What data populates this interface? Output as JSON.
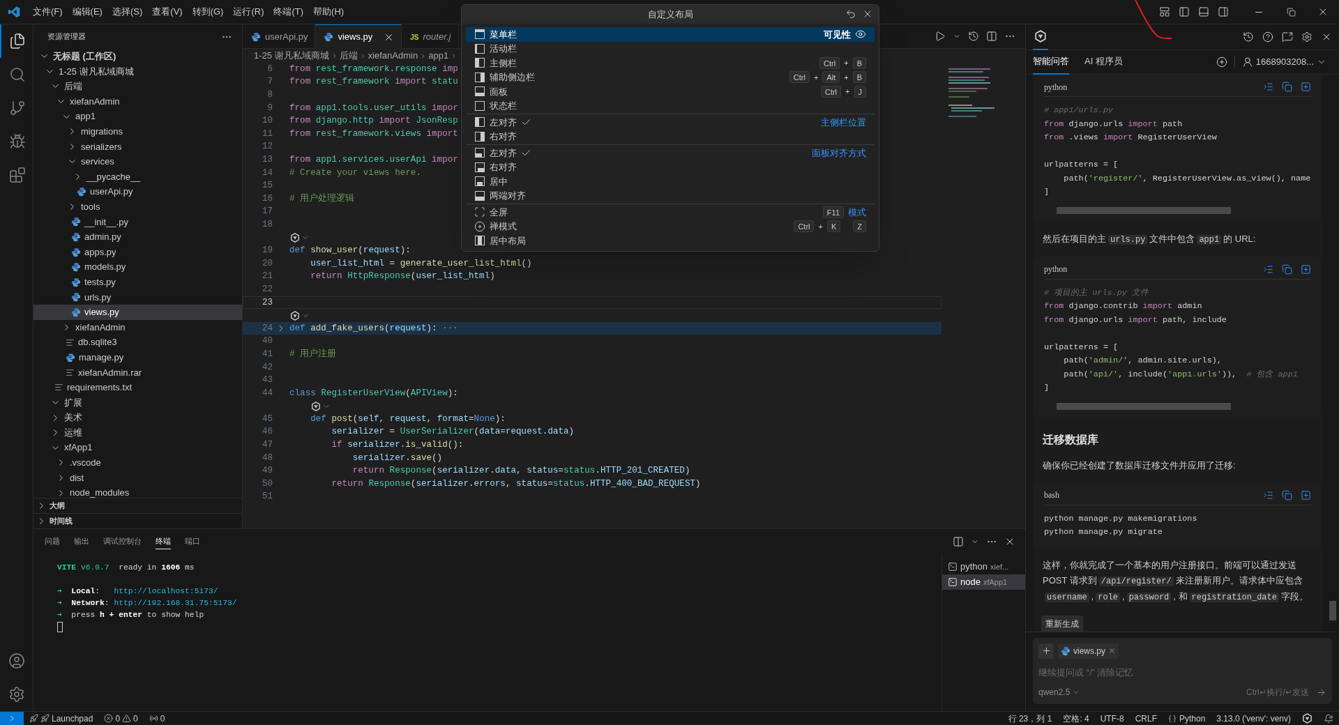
{
  "title_bar": {
    "menu": [
      "文件(F)",
      "编辑(E)",
      "选择(S)",
      "查看(V)",
      "转到(G)",
      "运行(R)",
      "终端(T)",
      "帮助(H)"
    ]
  },
  "activity_bar": {
    "items": [
      {
        "selected": true
      },
      {
        "selected": false
      },
      {
        "selected": false
      },
      {
        "selected": false
      },
      {
        "selected": false
      }
    ]
  },
  "sidebar": {
    "title": "资源管理器",
    "tree": [
      {
        "label": "无标题 (工作区)",
        "kind": "root",
        "expanded": true,
        "selected": false,
        "children": [
          {
            "label": "1-25 谢凡私域商城",
            "kind": "folder",
            "expanded": true,
            "selected": false,
            "children": [
              {
                "label": "后端",
                "kind": "folder",
                "expanded": true,
                "selected": false,
                "children": [
                  {
                    "label": "xiefanAdmin",
                    "kind": "folder",
                    "expanded": true,
                    "selected": false,
                    "children": [
                      {
                        "label": "app1",
                        "kind": "folder",
                        "expanded": true,
                        "selected": false,
                        "children": [
                          {
                            "label": "migrations",
                            "kind": "folder",
                            "expanded": false,
                            "selected": false
                          },
                          {
                            "label": "serializers",
                            "kind": "folder",
                            "expanded": false,
                            "selected": false
                          },
                          {
                            "label": "services",
                            "kind": "folder",
                            "expanded": true,
                            "selected": false,
                            "children": [
                              {
                                "label": "__pycache__",
                                "kind": "folder",
                                "expanded": false,
                                "selected": false
                              },
                              {
                                "label": "userApi.py",
                                "kind": "py",
                                "selected": false
                              }
                            ]
                          },
                          {
                            "label": "tools",
                            "kind": "folder",
                            "expanded": false,
                            "selected": false
                          },
                          {
                            "label": "__init__.py",
                            "kind": "py",
                            "selected": false
                          },
                          {
                            "label": "admin.py",
                            "kind": "py",
                            "selected": false
                          },
                          {
                            "label": "apps.py",
                            "kind": "py",
                            "selected": false
                          },
                          {
                            "label": "models.py",
                            "kind": "py",
                            "selected": false
                          },
                          {
                            "label": "tests.py",
                            "kind": "py",
                            "selected": false
                          },
                          {
                            "label": "urls.py",
                            "kind": "py",
                            "selected": false
                          },
                          {
                            "label": "views.py",
                            "kind": "py",
                            "selected": true
                          }
                        ]
                      },
                      {
                        "label": "xiefanAdmin",
                        "kind": "folder",
                        "expanded": false,
                        "selected": false
                      },
                      {
                        "label": "db.sqlite3",
                        "kind": "file",
                        "selected": false
                      },
                      {
                        "label": "manage.py",
                        "kind": "py",
                        "selected": false
                      },
                      {
                        "label": "xiefanAdmin.rar",
                        "kind": "file",
                        "selected": false
                      }
                    ]
                  }
                ]
              },
              {
                "label": "requirements.txt",
                "kind": "file",
                "selected": false
              },
              {
                "label": "扩展",
                "kind": "folder",
                "expanded": true,
                "selected": false
              },
              {
                "label": "美术",
                "kind": "folder",
                "expanded": false,
                "selected": false
              },
              {
                "label": "运维",
                "kind": "folder",
                "expanded": false,
                "selected": false
              },
              {
                "label": "xfApp1",
                "kind": "folder",
                "expanded": true,
                "selected": false,
                "children": [
                  {
                    "label": ".vscode",
                    "kind": "folder",
                    "expanded": false,
                    "selected": false
                  },
                  {
                    "label": "dist",
                    "kind": "folder",
                    "expanded": false,
                    "selected": false
                  },
                  {
                    "label": "node_modules",
                    "kind": "folder",
                    "expanded": false,
                    "selected": false
                  }
                ]
              }
            ]
          }
        ]
      }
    ],
    "sections": [
      {
        "label": "大纲",
        "expanded": false
      },
      {
        "label": "时间线",
        "expanded": false
      }
    ]
  },
  "editor": {
    "tabs": [
      {
        "label": "userApi.py",
        "kind": "py",
        "selected": false,
        "preview": false
      },
      {
        "label": "views.py",
        "kind": "py",
        "selected": true,
        "preview": false
      },
      {
        "label": "router.j",
        "kind": "js",
        "icon_text": "JS",
        "selected": false,
        "preview": true
      }
    ],
    "breadcrumb": [
      "1-25 谢凡私域商城",
      "后端",
      "xiefanAdmin",
      "app1"
    ],
    "lines": [
      {
        "kind": "code",
        "number": "6",
        "current": false,
        "folded": false,
        "tokens": [
          {
            "kind": "kw",
            "text": "from "
          },
          {
            "kind": "cls",
            "text": "rest_framework.response "
          },
          {
            "kind": "kw",
            "text": "imp"
          }
        ]
      },
      {
        "kind": "code",
        "number": "7",
        "current": false,
        "folded": false,
        "tokens": [
          {
            "kind": "kw",
            "text": "from "
          },
          {
            "kind": "cls",
            "text": "rest_framework "
          },
          {
            "kind": "kw",
            "text": "import "
          },
          {
            "kind": "cls",
            "text": "statu"
          }
        ]
      },
      {
        "kind": "blank",
        "number": "8",
        "current": false,
        "folded": false
      },
      {
        "kind": "code",
        "number": "9",
        "current": false,
        "folded": false,
        "tokens": [
          {
            "kind": "kw",
            "text": "from "
          },
          {
            "kind": "cls",
            "text": "app1.tools.user_utils "
          },
          {
            "kind": "kw",
            "text": "impor"
          }
        ]
      },
      {
        "kind": "code",
        "number": "10",
        "current": false,
        "folded": false,
        "tokens": [
          {
            "kind": "kw",
            "text": "from "
          },
          {
            "kind": "cls",
            "text": "django.http "
          },
          {
            "kind": "kw",
            "text": "import "
          },
          {
            "kind": "cls",
            "text": "JsonResp"
          }
        ]
      },
      {
        "kind": "code",
        "number": "11",
        "current": false,
        "folded": false,
        "tokens": [
          {
            "kind": "kw",
            "text": "from "
          },
          {
            "kind": "cls",
            "text": "rest_framework.views "
          },
          {
            "kind": "kw",
            "text": "import"
          }
        ]
      },
      {
        "kind": "blank",
        "number": "12",
        "current": false,
        "folded": false
      },
      {
        "kind": "code",
        "number": "13",
        "current": false,
        "folded": false,
        "tokens": [
          {
            "kind": "kw",
            "text": "from "
          },
          {
            "kind": "cls",
            "text": "app1.services.userApi "
          },
          {
            "kind": "kw",
            "text": "impor"
          }
        ]
      },
      {
        "kind": "code",
        "number": "14",
        "current": false,
        "folded": false,
        "tokens": [
          {
            "kind": "cm",
            "text": "# Create your views here."
          }
        ]
      },
      {
        "kind": "blank",
        "number": "15",
        "current": false,
        "folded": false
      },
      {
        "kind": "code",
        "number": "16",
        "current": false,
        "folded": false,
        "tokens": [
          {
            "kind": "cm",
            "text": "# 用户处理逻辑"
          }
        ]
      },
      {
        "kind": "blank",
        "number": "17",
        "current": false,
        "folded": false
      },
      {
        "kind": "blank",
        "number": "18",
        "current": false,
        "folded": false
      },
      {
        "kind": "lens"
      },
      {
        "kind": "code",
        "number": "19",
        "current": false,
        "folded": false,
        "tokens": [
          {
            "kind": "def",
            "text": "def "
          },
          {
            "kind": "fn",
            "text": "show_user"
          },
          {
            "kind": "p",
            "text": "("
          },
          {
            "kind": "var",
            "text": "request"
          },
          {
            "kind": "p",
            "text": "):"
          }
        ]
      },
      {
        "kind": "code",
        "number": "20",
        "current": false,
        "folded": false,
        "tokens": [
          {
            "kind": "var",
            "text": "    user_list_html"
          },
          {
            "kind": "p",
            "text": " = "
          },
          {
            "kind": "fn",
            "text": "generate_user_list_html"
          },
          {
            "kind": "p",
            "text": "()"
          }
        ]
      },
      {
        "kind": "code",
        "number": "21",
        "current": false,
        "folded": false,
        "tokens": [
          {
            "kind": "kw",
            "text": "    return "
          },
          {
            "kind": "cls",
            "text": "HttpResponse"
          },
          {
            "kind": "p",
            "text": "("
          },
          {
            "kind": "var",
            "text": "user_list_html"
          },
          {
            "kind": "p",
            "text": ")"
          }
        ]
      },
      {
        "kind": "blank",
        "number": "22",
        "current": false,
        "folded": false
      },
      {
        "kind": "blank",
        "number": "23",
        "current": true,
        "folded": false
      },
      {
        "kind": "lens"
      },
      {
        "kind": "code",
        "number": "24",
        "current": false,
        "folded": true,
        "tokens": [
          {
            "kind": "def",
            "text": "def "
          },
          {
            "kind": "fn",
            "text": "add_fake_users"
          },
          {
            "kind": "p",
            "text": "("
          },
          {
            "kind": "var",
            "text": "request"
          },
          {
            "kind": "p",
            "text": "):"
          },
          {
            "kind": "fold",
            "text": " ···"
          }
        ]
      },
      {
        "kind": "blank",
        "number": "40",
        "current": false,
        "folded": false
      },
      {
        "kind": "code",
        "number": "41",
        "current": false,
        "folded": false,
        "tokens": [
          {
            "kind": "cm",
            "text": "# 用户注册"
          }
        ]
      },
      {
        "kind": "blank",
        "number": "42",
        "current": false,
        "folded": false
      },
      {
        "kind": "blank",
        "number": "43",
        "current": false,
        "folded": false
      },
      {
        "kind": "code",
        "number": "44",
        "current": false,
        "folded": false,
        "tokens": [
          {
            "kind": "def",
            "text": "class "
          },
          {
            "kind": "cls",
            "text": "RegisterUserView"
          },
          {
            "kind": "p",
            "text": "("
          },
          {
            "kind": "cls",
            "text": "APIView"
          },
          {
            "kind": "p",
            "text": "):"
          }
        ]
      },
      {
        "kind": "lens-inner"
      },
      {
        "kind": "code",
        "number": "45",
        "current": false,
        "folded": false,
        "tokens": [
          {
            "kind": "def",
            "text": "    def "
          },
          {
            "kind": "fn",
            "text": "post"
          },
          {
            "kind": "p",
            "text": "("
          },
          {
            "kind": "var",
            "text": "self"
          },
          {
            "kind": "p",
            "text": ", "
          },
          {
            "kind": "var",
            "text": "request"
          },
          {
            "kind": "p",
            "text": ", "
          },
          {
            "kind": "var",
            "text": "format"
          },
          {
            "kind": "p",
            "text": "="
          },
          {
            "kind": "def",
            "text": "None"
          },
          {
            "kind": "p",
            "text": "):"
          }
        ]
      },
      {
        "kind": "code",
        "number": "46",
        "current": false,
        "folded": false,
        "tokens": [
          {
            "kind": "var",
            "text": "        serializer"
          },
          {
            "kind": "p",
            "text": " = "
          },
          {
            "kind": "cls",
            "text": "UserSerializer"
          },
          {
            "kind": "p",
            "text": "("
          },
          {
            "kind": "var",
            "text": "data"
          },
          {
            "kind": "p",
            "text": "="
          },
          {
            "kind": "var",
            "text": "request"
          },
          {
            "kind": "p",
            "text": "."
          },
          {
            "kind": "var",
            "text": "data"
          },
          {
            "kind": "p",
            "text": ")"
          }
        ]
      },
      {
        "kind": "code",
        "number": "47",
        "current": false,
        "folded": false,
        "tokens": [
          {
            "kind": "kw",
            "text": "        if "
          },
          {
            "kind": "var",
            "text": "serializer"
          },
          {
            "kind": "p",
            "text": "."
          },
          {
            "kind": "fn",
            "text": "is_valid"
          },
          {
            "kind": "p",
            "text": "():"
          }
        ]
      },
      {
        "kind": "code",
        "number": "48",
        "current": false,
        "folded": false,
        "tokens": [
          {
            "kind": "var",
            "text": "            serializer"
          },
          {
            "kind": "p",
            "text": "."
          },
          {
            "kind": "fn",
            "text": "save"
          },
          {
            "kind": "p",
            "text": "()"
          }
        ]
      },
      {
        "kind": "code",
        "number": "49",
        "current": false,
        "folded": false,
        "tokens": [
          {
            "kind": "kw",
            "text": "            return "
          },
          {
            "kind": "cls",
            "text": "Response"
          },
          {
            "kind": "p",
            "text": "("
          },
          {
            "kind": "var",
            "text": "serializer"
          },
          {
            "kind": "p",
            "text": "."
          },
          {
            "kind": "var",
            "text": "data"
          },
          {
            "kind": "p",
            "text": ", "
          },
          {
            "kind": "var",
            "text": "status"
          },
          {
            "kind": "p",
            "text": "="
          },
          {
            "kind": "cls",
            "text": "status"
          },
          {
            "kind": "p",
            "text": "."
          },
          {
            "kind": "var",
            "text": "HTTP_201_CREATED"
          },
          {
            "kind": "p",
            "text": ")"
          }
        ]
      },
      {
        "kind": "code",
        "number": "50",
        "current": false,
        "folded": false,
        "tokens": [
          {
            "kind": "kw",
            "text": "        return "
          },
          {
            "kind": "cls",
            "text": "Response"
          },
          {
            "kind": "p",
            "text": "("
          },
          {
            "kind": "var",
            "text": "serializer"
          },
          {
            "kind": "p",
            "text": "."
          },
          {
            "kind": "var",
            "text": "errors"
          },
          {
            "kind": "p",
            "text": ", "
          },
          {
            "kind": "var",
            "text": "status"
          },
          {
            "kind": "p",
            "text": "="
          },
          {
            "kind": "cls",
            "text": "status"
          },
          {
            "kind": "p",
            "text": "."
          },
          {
            "kind": "var",
            "text": "HTTP_400_BAD_REQUEST"
          },
          {
            "kind": "p",
            "text": ")"
          }
        ]
      },
      {
        "kind": "blank",
        "number": "51",
        "current": false,
        "folded": false
      }
    ]
  },
  "layout_menu": {
    "title": "自定义布局",
    "sections": [
      {
        "label": "可见性",
        "items": [
          {
            "label": "菜单栏",
            "selected": true
          },
          {
            "label": "活动栏",
            "selected": false
          },
          {
            "label": "主侧栏",
            "selected": false,
            "keys": [
              {
                "kind": "key",
                "text": "Ctrl"
              },
              {
                "kind": "plus",
                "text": "+"
              },
              {
                "kind": "key",
                "text": "B"
              }
            ]
          },
          {
            "label": "辅助侧边栏",
            "selected": false,
            "keys": [
              {
                "kind": "key",
                "text": "Ctrl"
              },
              {
                "kind": "plus",
                "text": "+"
              },
              {
                "kind": "key",
                "text": "Alt"
              },
              {
                "kind": "plus",
                "text": "+"
              },
              {
                "kind": "key",
                "text": "B"
              }
            ]
          },
          {
            "label": "面板",
            "selected": false,
            "keys": [
              {
                "kind": "key",
                "text": "Ctrl"
              },
              {
                "kind": "plus",
                "text": "+"
              },
              {
                "kind": "key",
                "text": "J"
              }
            ]
          },
          {
            "label": "状态栏",
            "selected": false
          }
        ]
      },
      {
        "label": "主侧栏位置",
        "items": [
          {
            "label": "左对齐",
            "selected": false,
            "checked": true
          },
          {
            "label": "右对齐",
            "selected": false,
            "checked": false
          }
        ]
      },
      {
        "label": "面板对齐方式",
        "items": [
          {
            "label": "左对齐",
            "selected": false,
            "checked": true
          },
          {
            "label": "右对齐",
            "selected": false,
            "checked": false
          },
          {
            "label": "居中",
            "selected": false,
            "checked": false
          },
          {
            "label": "两端对齐",
            "selected": false,
            "checked": false
          }
        ]
      },
      {
        "label": "模式",
        "items": [
          {
            "label": "全屏",
            "selected": false,
            "keys": [
              {
                "kind": "key",
                "text": "F11"
              }
            ]
          },
          {
            "label": "禅模式",
            "selected": false,
            "keys": [
              {
                "kind": "key",
                "text": "Ctrl"
              },
              {
                "kind": "plus",
                "text": "+"
              },
              {
                "kind": "key",
                "text": "K"
              },
              {
                "kind": "gap"
              },
              {
                "kind": "key",
                "text": "Z"
              }
            ]
          },
          {
            "label": "居中布局",
            "selected": false
          }
        ]
      }
    ]
  },
  "panel": {
    "tabs": [
      {
        "label": "问题",
        "selected": false
      },
      {
        "label": "输出",
        "selected": false
      },
      {
        "label": "调试控制台",
        "selected": false
      },
      {
        "label": "终端",
        "selected": true
      },
      {
        "label": "端口",
        "selected": false
      }
    ],
    "terminal": [
      {
        "kind": "text",
        "tokens": [
          {
            "kind": "greenbold",
            "text": "VITE"
          },
          {
            "kind": "green",
            "text": " v6.0.7"
          },
          {
            "kind": "p",
            "text": "  ready in "
          },
          {
            "kind": "bold",
            "text": "1606"
          },
          {
            "kind": "p",
            "text": " ms"
          }
        ]
      },
      {
        "kind": "blank"
      },
      {
        "kind": "text",
        "tokens": [
          {
            "kind": "green",
            "text": "➜"
          },
          {
            "kind": "bold",
            "text": "  Local"
          },
          {
            "kind": "p",
            "text": ":   "
          },
          {
            "kind": "cyan",
            "text": "http://localhost:5173/"
          }
        ]
      },
      {
        "kind": "text",
        "tokens": [
          {
            "kind": "green",
            "text": "➜"
          },
          {
            "kind": "bold",
            "text": "  Network"
          },
          {
            "kind": "p",
            "text": ": "
          },
          {
            "kind": "cyan",
            "text": "http://192.168.31.75:5173/"
          }
        ]
      },
      {
        "kind": "text",
        "tokens": [
          {
            "kind": "green",
            "text": "➜"
          },
          {
            "kind": "p",
            "text": "  press "
          },
          {
            "kind": "bold",
            "text": "h + enter"
          },
          {
            "kind": "p",
            "text": " to show help"
          }
        ]
      },
      {
        "kind": "cursor"
      }
    ],
    "terminals": [
      {
        "label": "python",
        "detail": "xief...",
        "selected": false
      },
      {
        "label": "node",
        "detail": "xfApp1",
        "selected": true
      }
    ]
  },
  "aux_panel": {
    "tabs": [
      {
        "label": "智能问答",
        "selected": true
      },
      {
        "label": "AI 程序员",
        "selected": false
      }
    ],
    "account": "1668903208...",
    "chat": [
      {
        "kind": "code",
        "language": "python",
        "lines": [
          {
            "kind": "code",
            "tokens": [
              {
                "kind": "ccm",
                "text": "# app1/urls.py"
              }
            ]
          },
          {
            "kind": "code",
            "tokens": [
              {
                "kind": "kw",
                "text": "from"
              },
              {
                "kind": "p",
                "text": " django.urls "
              },
              {
                "kind": "kw",
                "text": "import"
              },
              {
                "kind": "p",
                "text": " path"
              }
            ]
          },
          {
            "kind": "code",
            "tokens": [
              {
                "kind": "kw",
                "text": "from"
              },
              {
                "kind": "p",
                "text": " .views "
              },
              {
                "kind": "kw",
                "text": "import"
              },
              {
                "kind": "p",
                "text": " RegisterUserView"
              }
            ]
          },
          {
            "kind": "blank"
          },
          {
            "kind": "code",
            "tokens": [
              {
                "kind": "p",
                "text": "urlpatterns = ["
              }
            ]
          },
          {
            "kind": "code",
            "tokens": [
              {
                "kind": "p",
                "text": "    path("
              },
              {
                "kind": "cstr",
                "text": "'register/'"
              },
              {
                "kind": "p",
                "text": ", RegisterUserView.as_view(), name"
              }
            ]
          },
          {
            "kind": "code",
            "tokens": [
              {
                "kind": "p",
                "text": "]"
              }
            ]
          }
        ]
      },
      {
        "kind": "paragraph",
        "segments": [
          {
            "kind": "text",
            "text": "然后在项目的主"
          },
          {
            "kind": "code",
            "text": "urls.py"
          },
          {
            "kind": "text",
            "text": "文件中包含"
          },
          {
            "kind": "code",
            "text": "app1"
          },
          {
            "kind": "text",
            "text": "的 URL:"
          }
        ]
      },
      {
        "kind": "code",
        "language": "python",
        "lines": [
          {
            "kind": "code",
            "tokens": [
              {
                "kind": "ccm",
                "text": "# 项目的主 urls.py 文件"
              }
            ]
          },
          {
            "kind": "code",
            "tokens": [
              {
                "kind": "kw",
                "text": "from"
              },
              {
                "kind": "p",
                "text": " django.contrib "
              },
              {
                "kind": "kw",
                "text": "import"
              },
              {
                "kind": "p",
                "text": " admin"
              }
            ]
          },
          {
            "kind": "code",
            "tokens": [
              {
                "kind": "kw",
                "text": "from"
              },
              {
                "kind": "p",
                "text": " django.urls "
              },
              {
                "kind": "kw",
                "text": "import"
              },
              {
                "kind": "p",
                "text": " path, include"
              }
            ]
          },
          {
            "kind": "blank"
          },
          {
            "kind": "code",
            "tokens": [
              {
                "kind": "p",
                "text": "urlpatterns = ["
              }
            ]
          },
          {
            "kind": "code",
            "tokens": [
              {
                "kind": "p",
                "text": "    path("
              },
              {
                "kind": "cstr",
                "text": "'admin/'"
              },
              {
                "kind": "p",
                "text": ", admin.site.urls),"
              }
            ]
          },
          {
            "kind": "code",
            "tokens": [
              {
                "kind": "p",
                "text": "    path("
              },
              {
                "kind": "cstr",
                "text": "'api/'"
              },
              {
                "kind": "p",
                "text": ", include("
              },
              {
                "kind": "cstr",
                "text": "'app1.urls'"
              },
              {
                "kind": "p",
                "text": ")),  "
              },
              {
                "kind": "ccm",
                "text": "# 包含 app1"
              }
            ]
          },
          {
            "kind": "code",
            "tokens": [
              {
                "kind": "p",
                "text": "]"
              }
            ]
          }
        ]
      },
      {
        "kind": "heading",
        "text": "迁移数据库"
      },
      {
        "kind": "paragraph",
        "segments": [
          {
            "kind": "text",
            "text": "确保你已经创建了数据库迁移文件并应用了迁移:"
          }
        ]
      },
      {
        "kind": "code",
        "language": "bash",
        "lines": [
          {
            "kind": "code",
            "tokens": [
              {
                "kind": "p",
                "text": "python manage.py makemigrations"
              }
            ]
          },
          {
            "kind": "code",
            "tokens": [
              {
                "kind": "p",
                "text": "python manage.py migrate"
              }
            ]
          }
        ]
      },
      {
        "kind": "paragraph",
        "segments": [
          {
            "kind": "text",
            "text": "这样，你就完成了一个基本的用户注册接口。前端可以通过发送 POST 请求到"
          },
          {
            "kind": "code",
            "text": "/api/register/"
          },
          {
            "kind": "text",
            "text": "来注册新用户。请求体中应包含"
          },
          {
            "kind": "code",
            "text": "username"
          },
          {
            "kind": "text",
            "text": ","
          },
          {
            "kind": "code",
            "text": "role"
          },
          {
            "kind": "text",
            "text": ","
          },
          {
            "kind": "code",
            "text": "password"
          },
          {
            "kind": "text",
            "text": ", 和"
          },
          {
            "kind": "code",
            "text": "registration_date"
          },
          {
            "kind": "text",
            "text": "字段。"
          }
        ]
      }
    ],
    "regenerate": "重新生成",
    "input": {
      "attachment": "views.py",
      "placeholder": "继续提问或 “/” 清除记忆",
      "model": "qwen2.5",
      "hint": "Ctrl↵换行/↵发送"
    }
  },
  "status_bar": {
    "left": [
      {
        "kind": "remote"
      },
      {
        "kind": "launchpad",
        "text": "Launchpad"
      },
      {
        "kind": "problems",
        "errors": "0",
        "warnings": "0"
      },
      {
        "kind": "ports",
        "text": "0"
      }
    ],
    "right": [
      {
        "kind": "text",
        "text": "行 23，列 1"
      },
      {
        "kind": "text",
        "text": "空格: 4"
      },
      {
        "kind": "text",
        "text": "UTF-8"
      },
      {
        "kind": "text",
        "text": "CRLF"
      },
      {
        "kind": "language",
        "text": "Python"
      },
      {
        "kind": "text",
        "text": "3.13.0 ('venv': venv)"
      }
    ]
  }
}
